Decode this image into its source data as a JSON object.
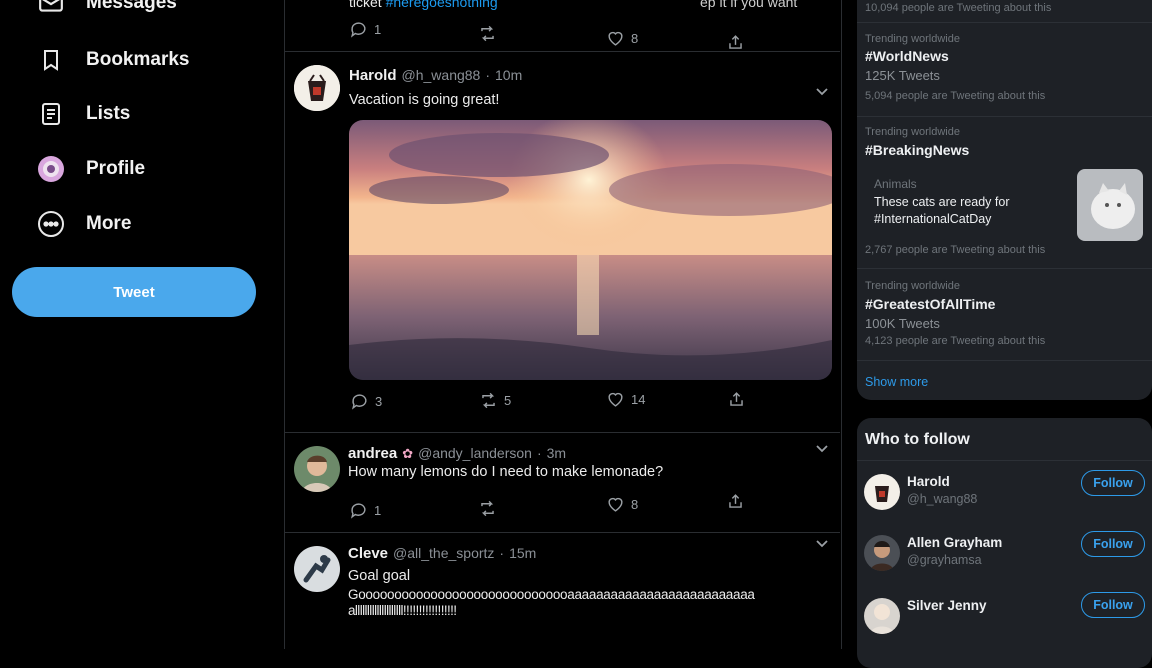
{
  "nav": {
    "messages": "Messages",
    "bookmarks": "Bookmarks",
    "lists": "Lists",
    "profile": "Profile",
    "more": "More",
    "tweet_button": "Tweet"
  },
  "feed": {
    "top_partial": {
      "text_start": "ticket",
      "hashtag": "#heregoesnothing",
      "text_right": "ep it if you want",
      "replies": "1",
      "likes": "8"
    },
    "tweets": [
      {
        "name": "Harold",
        "handle": "@h_wang88",
        "time": "10m",
        "text": "Vacation is going great!",
        "replies": "3",
        "retweets": "5",
        "likes": "14"
      },
      {
        "name": "andrea",
        "handle": "@andy_landerson",
        "time": "3m",
        "text": "How many lemons do I need to make lemonade?",
        "replies": "1",
        "retweets": "",
        "likes": "8"
      },
      {
        "name": "Cleve",
        "handle": "@all_the_sportz",
        "time": "15m",
        "text": "Goal goal",
        "text2": "Goooooooooooooooooooooooooooooaaaaaaaaaaaaaaaaaaaaaaaaaa",
        "text3": "allllllllllllllllllll!!!!!!!!!!!!!!!!!"
      }
    ],
    "separator": "·"
  },
  "trends": {
    "top_partial": "10,094 people are Tweeting about this",
    "items": [
      {
        "context": "Trending worldwide",
        "tag": "#WorldNews",
        "count": "125K Tweets",
        "people": "5,094 people are Tweeting about this"
      },
      {
        "context": "Trending worldwide",
        "tag": "#BreakingNews",
        "card_category": "Animals",
        "card_line1": "These cats are ready for",
        "card_line2": "#InternationalCatDay",
        "people": "2,767 people are Tweeting about this"
      },
      {
        "context": "Trending worldwide",
        "tag": "#GreatestOfAllTime",
        "count": "100K Tweets",
        "people": "4,123 people are Tweeting about this"
      }
    ],
    "show_more": "Show more"
  },
  "who_to_follow": {
    "title": "Who to follow",
    "follow_label": "Follow",
    "users": [
      {
        "name": "Harold",
        "handle": "@h_wang88"
      },
      {
        "name": "Allen Grayham",
        "handle": "@grayhamsa"
      },
      {
        "name": "Silver Jenny",
        "handle": ""
      }
    ]
  },
  "colors": {
    "accent": "#1d9bf0",
    "tweet_button": "#4aa8ec",
    "background": "#000000",
    "panel": "#1e2126"
  }
}
